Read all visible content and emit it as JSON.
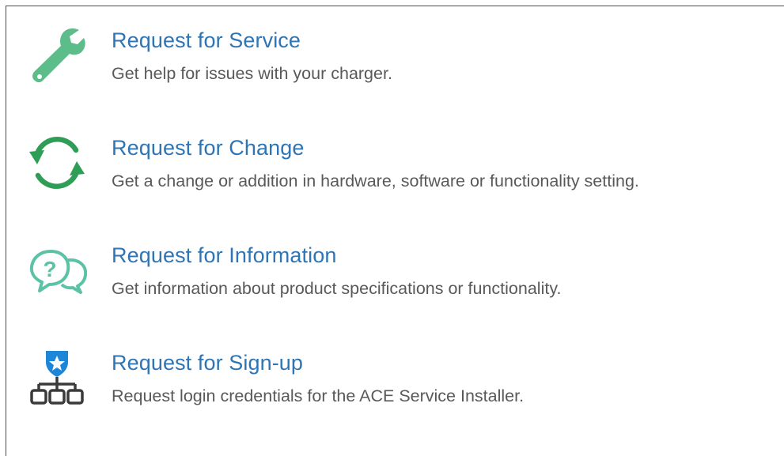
{
  "items": [
    {
      "title": "Request for Service",
      "description": "Get help for issues with your charger.",
      "icon": "wrench-icon",
      "icon_color": "#5dbd8a"
    },
    {
      "title": "Request for Change",
      "description": "Get a change or addition in hardware, software or functionality setting.",
      "icon": "refresh-icon",
      "icon_color": "#2e9e57"
    },
    {
      "title": "Request for Information",
      "description": "Get information about product specifications or functionality.",
      "icon": "question-chat-icon",
      "icon_color": "#5cc2a6"
    },
    {
      "title": "Request for Sign-up",
      "description": "Request login credentials for the ACE Service Installer.",
      "icon": "network-star-icon",
      "icon_color": "#1e86d6"
    }
  ],
  "colors": {
    "title": "#2e75b6",
    "description": "#595959"
  }
}
